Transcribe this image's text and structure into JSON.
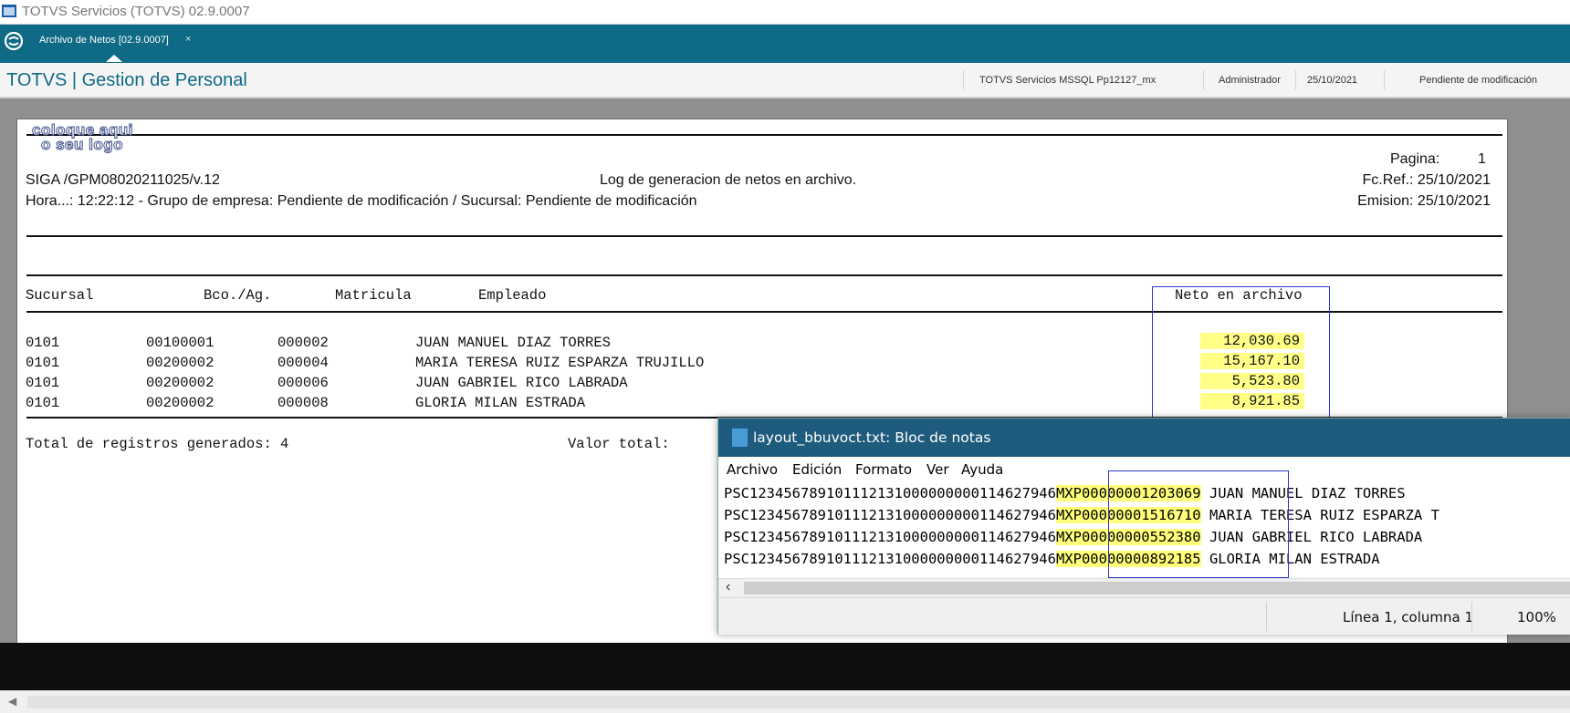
{
  "window": {
    "title": "TOTVS Servicios (TOTVS) 02.9.0007"
  },
  "tabs": [
    {
      "label": "Archivo de Netos [02.9.0007]",
      "close": "×"
    }
  ],
  "header": {
    "title": "TOTVS | Gestion de Personal",
    "environment": "TOTVS Servicios MSSQL Pp12127_mx",
    "user": "Administrador",
    "date": "25/10/2021",
    "status": "Pendiente de modificación"
  },
  "report": {
    "logo_line1": "coloque aqui",
    "logo_line2": "o seu logo",
    "program": "SIGA /GPM08020211025/v.12",
    "title": "Log de generacion de netos en archivo.",
    "page_label": "Pagina:",
    "page_number": "1",
    "fc_ref": "Fc.Ref.: 25/10/2021",
    "emision": "Emision: 25/10/2021",
    "hora_line": "Hora...: 12:22:12 - Grupo de empresa: Pendiente de modificación / Sucursal: Pendiente de modificación",
    "columns": {
      "sucursal": "Sucursal",
      "bco": "Bco./Ag.",
      "matricula": "Matricula",
      "empleado": "Empleado",
      "neto": "Neto en archivo"
    },
    "rows": [
      {
        "sucursal": "0101",
        "bco": "00100001",
        "matricula": "000002",
        "empleado": "JUAN MANUEL DIAZ TORRES",
        "neto": "12,030.69"
      },
      {
        "sucursal": "0101",
        "bco": "00200002",
        "matricula": "000004",
        "empleado": "MARIA TERESA RUIZ ESPARZA TRUJILLO",
        "neto": "15,167.10"
      },
      {
        "sucursal": "0101",
        "bco": "00200002",
        "matricula": "000006",
        "empleado": "JUAN GABRIEL RICO LABRADA",
        "neto": "5,523.80"
      },
      {
        "sucursal": "0101",
        "bco": "00200002",
        "matricula": "000008",
        "empleado": "GLORIA MILAN ESTRADA",
        "neto": "8,921.85"
      }
    ],
    "total_label": "Total de registros generados: 4",
    "valor_total_label": "Valor total:"
  },
  "notepad": {
    "title": "layout_bbuvoct.txt: Bloc de notas",
    "menu": [
      "Archivo",
      "Edición",
      "Formato",
      "Ver",
      "Ayuda"
    ],
    "lines": [
      {
        "prefix": "PSC123456789101112131000000000114627946",
        "amount": "MXP00000001203069",
        "name": "JUAN MANUEL DIAZ TORRES"
      },
      {
        "prefix": "PSC123456789101112131000000000114627946",
        "amount": "MXP00000001516710",
        "name": "MARIA TERESA RUIZ ESPARZA T"
      },
      {
        "prefix": "PSC123456789101112131000000000114627946",
        "amount": "MXP00000000552380",
        "name": "JUAN GABRIEL RICO LABRADA"
      },
      {
        "prefix": "PSC123456789101112131000000000114627946",
        "amount": "MXP00000000892185",
        "name": "GLORIA MILAN ESTRADA"
      }
    ],
    "status_position": "Línea 1, columna 1",
    "status_zoom": "100%"
  },
  "colors": {
    "accent": "#0f6a85",
    "highlight": "#ffff88",
    "box": "#2b35c8"
  }
}
